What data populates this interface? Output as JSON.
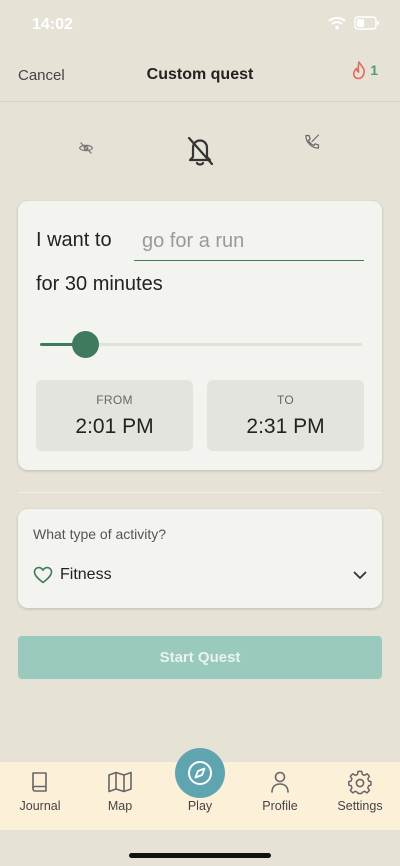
{
  "status_bar": {
    "time": "14:02"
  },
  "nav": {
    "cancel_label": "Cancel",
    "title": "Custom quest",
    "streak_count": "1"
  },
  "modes": [
    "eye-off-icon",
    "bell-off-icon",
    "phone-off-icon"
  ],
  "quest": {
    "prefix": "I want to",
    "input_placeholder": "go for a run",
    "input_value": "",
    "duration_text": "for 30 minutes",
    "slider_fraction": 0.14,
    "from_label": "FROM",
    "from_time": "2:01 PM",
    "to_label": "TO",
    "to_time": "2:31 PM"
  },
  "activity": {
    "prompt": "What type of activity?",
    "selected": "Fitness"
  },
  "start_button": {
    "label": "Start Quest"
  },
  "tabs": [
    {
      "label": "Journal",
      "icon": "book-icon"
    },
    {
      "label": "Map",
      "icon": "map-icon"
    },
    {
      "label": "Play",
      "icon": "compass-icon"
    },
    {
      "label": "Profile",
      "icon": "person-icon"
    },
    {
      "label": "Settings",
      "icon": "gear-icon"
    }
  ],
  "colors": {
    "accent": "#3f7a5e",
    "play": "#5fa5b0",
    "start_button": "#9ac9bd",
    "background": "#e6e3d6",
    "tabbar": "#fdf0d9"
  }
}
